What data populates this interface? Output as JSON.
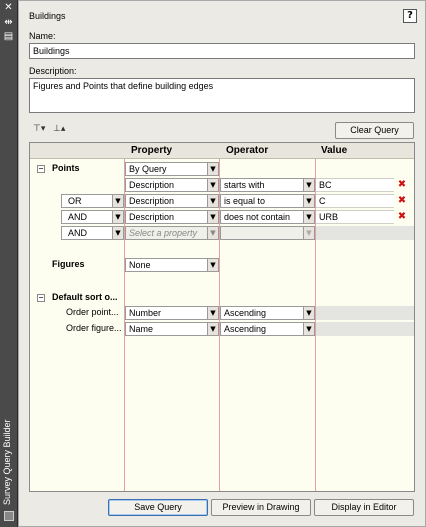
{
  "sidebar": {
    "title": "Survey Query Builder",
    "close_glyph": "✕",
    "dock_glyph": "⇹",
    "props_glyph": "▤"
  },
  "header": {
    "title": "Buildings",
    "help_label": "?"
  },
  "name": {
    "label": "Name:",
    "value": "Buildings"
  },
  "description": {
    "label": "Description:",
    "value": "Figures and Points that define building edges"
  },
  "toolbar": {
    "clear_label": "Clear Query"
  },
  "grid": {
    "headers": {
      "property": "Property",
      "operator": "Operator",
      "value": "Value"
    },
    "points": {
      "label": "Points",
      "by_query": "By Query",
      "rows": [
        {
          "conj": "",
          "property": "Description",
          "operator": "starts with",
          "value": "BC"
        },
        {
          "conj": "OR",
          "property": "Description",
          "operator": "is equal to",
          "value": "C"
        },
        {
          "conj": "AND",
          "property": "Description",
          "operator": "does not contain",
          "value": "URB"
        }
      ],
      "new_row": {
        "conj": "AND",
        "property_placeholder": "Select a property"
      }
    },
    "figures": {
      "label": "Figures",
      "value": "None"
    },
    "sort": {
      "label": "Default sort o...",
      "rows": [
        {
          "label": "Order point...",
          "property": "Number",
          "operator": "Ascending"
        },
        {
          "label": "Order figure...",
          "property": "Name",
          "operator": "Ascending"
        }
      ]
    }
  },
  "footer": {
    "save_label": "Save Query",
    "preview_label": "Preview in Drawing",
    "display_label": "Display in Editor"
  },
  "colors": {
    "delete": "#d01010",
    "grid_bg": "#fdfdf0",
    "row_line": "#e8a0a0"
  }
}
